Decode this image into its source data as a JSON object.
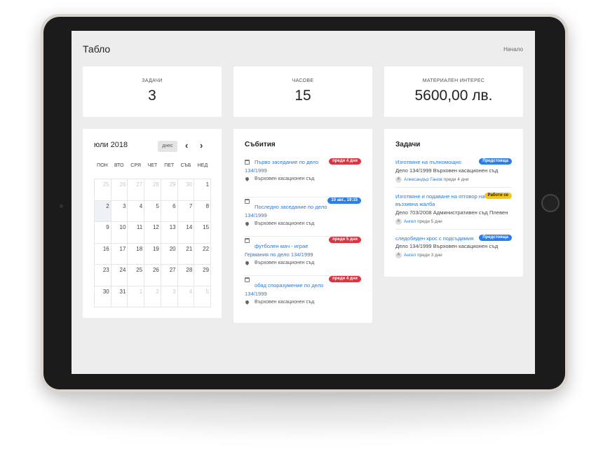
{
  "header": {
    "title": "Табло",
    "breadcrumb": "Начало"
  },
  "stats": [
    {
      "label": "ЗАДАЧИ",
      "value": "3"
    },
    {
      "label": "ЧАСОВЕ",
      "value": "15"
    },
    {
      "label": "МАТЕРИАЛЕН ИНТЕРЕС",
      "value": "5600,00 лв."
    }
  ],
  "calendar": {
    "month": "юли 2018",
    "today_label": "днес",
    "prev_icon": "‹",
    "next_icon": "›",
    "weekdays": [
      "ПОН",
      "ВТО",
      "СРЯ",
      "ЧЕТ",
      "ПЕТ",
      "СЪБ",
      "НЕД"
    ],
    "weeks": [
      [
        "25",
        "26",
        "27",
        "28",
        "29",
        "30",
        "1"
      ],
      [
        "2",
        "3",
        "4",
        "5",
        "6",
        "7",
        "8"
      ],
      [
        "9",
        "10",
        "11",
        "12",
        "13",
        "14",
        "15"
      ],
      [
        "16",
        "17",
        "18",
        "19",
        "20",
        "21",
        "22"
      ],
      [
        "23",
        "24",
        "25",
        "26",
        "27",
        "28",
        "29"
      ],
      [
        "30",
        "31",
        "1",
        "2",
        "3",
        "4",
        "5"
      ]
    ]
  },
  "events": {
    "title": "Събития",
    "items": [
      {
        "title": "Първо заседание по дело 134/1999",
        "badge": "преди 4 дни",
        "badge_color": "#d9343f",
        "place": "Върховен касационен съд"
      },
      {
        "title": "Последно заседание по дело 134/1999",
        "badge": "10 авг., 19:15",
        "badge_color": "#2a7ee6",
        "place": "Върховен касационен съд"
      },
      {
        "title": "футболен мач - играе Германия по дело 134/1999",
        "badge": "преди 5 дни",
        "badge_color": "#d9343f",
        "place": "Върховен касационен съд"
      },
      {
        "title": "обяд споразумение по дело 134/1999",
        "badge": "преди 4 дни",
        "badge_color": "#d9343f",
        "place": "Върховен касационен съд"
      }
    ]
  },
  "tasks": {
    "title": "Задачи",
    "items": [
      {
        "title": "Изготвяне на пълномощно",
        "badge": "Предстояща",
        "badge_color": "#2a7ee6",
        "badge_text_color": "#ffffff",
        "desc": "Дело 134/1999 Върховен касационен съд",
        "avatar": "А",
        "author": "Александър Ганов",
        "time": "преди 4 дни"
      },
      {
        "title": "Изготвяне и подаване на отговор на въззивна жалба",
        "badge": "Работи се",
        "badge_color": "#f5c518",
        "badge_text_color": "#222222",
        "desc": "Дело 703/2008 Административен съд Плевен",
        "avatar": "А",
        "author": "Ангел",
        "time": "преди 5 дни"
      },
      {
        "title": "следобеден крос с подсъдимия",
        "badge": "Предстояща",
        "badge_color": "#2a7ee6",
        "badge_text_color": "#ffffff",
        "desc": "Дело 134/1999 Върховен касационен съд",
        "avatar": "А",
        "author": "Ангел",
        "time": "преди 3 дни"
      }
    ]
  }
}
